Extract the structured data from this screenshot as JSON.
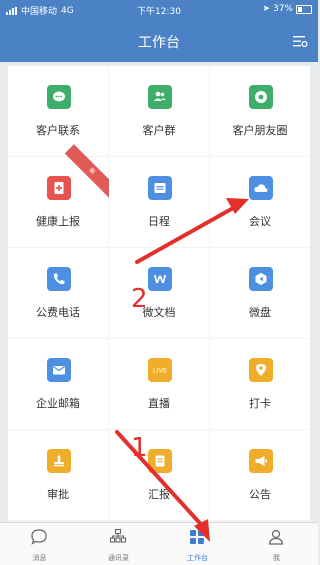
{
  "status_bar": {
    "carrier": "中国移动",
    "network": "4G",
    "time": "下午12:30",
    "battery": "37%"
  },
  "header": {
    "title": "工作台"
  },
  "apps": [
    {
      "label": "客户联系",
      "icon": "chat-icon",
      "color": "#3fae6b"
    },
    {
      "label": "客户群",
      "icon": "people-icon",
      "color": "#3fae6b"
    },
    {
      "label": "客户朋友圈",
      "icon": "aperture-icon",
      "color": "#3fae6b"
    },
    {
      "label": "健康上报",
      "icon": "health-report-icon",
      "color": "#e8534f",
      "badge": "新"
    },
    {
      "label": "日程",
      "icon": "calendar-icon",
      "color": "#4d8fe0"
    },
    {
      "label": "会议",
      "icon": "cloud-icon",
      "color": "#4d8fe0"
    },
    {
      "label": "公费电话",
      "icon": "phone-icon",
      "color": "#4d8fe0"
    },
    {
      "label": "微文档",
      "icon": "document-w-icon",
      "color": "#4d8fe0"
    },
    {
      "label": "微盘",
      "icon": "disk-icon",
      "color": "#4d8fe0"
    },
    {
      "label": "企业邮箱",
      "icon": "mail-icon",
      "color": "#4d8fe0"
    },
    {
      "label": "直播",
      "icon": "live-icon",
      "color": "#f0ad2c",
      "icon_text": "LIVE"
    },
    {
      "label": "打卡",
      "icon": "location-pin-icon",
      "color": "#f0ad2c"
    },
    {
      "label": "审批",
      "icon": "approval-icon",
      "color": "#f0ad2c"
    },
    {
      "label": "汇报",
      "icon": "report-icon",
      "color": "#f0ad2c"
    },
    {
      "label": "公告",
      "icon": "megaphone-icon",
      "color": "#f0ad2c"
    }
  ],
  "tabs": [
    {
      "label": "消息",
      "icon": "message-bubble-icon",
      "active": false
    },
    {
      "label": "通讯录",
      "icon": "org-chart-icon",
      "active": false
    },
    {
      "label": "工作台",
      "icon": "workbench-icon",
      "active": true
    },
    {
      "label": "我",
      "icon": "person-icon",
      "active": false
    }
  ],
  "annotations": {
    "step1": "1",
    "step2": "2",
    "arrow_color": "#e3302a"
  }
}
